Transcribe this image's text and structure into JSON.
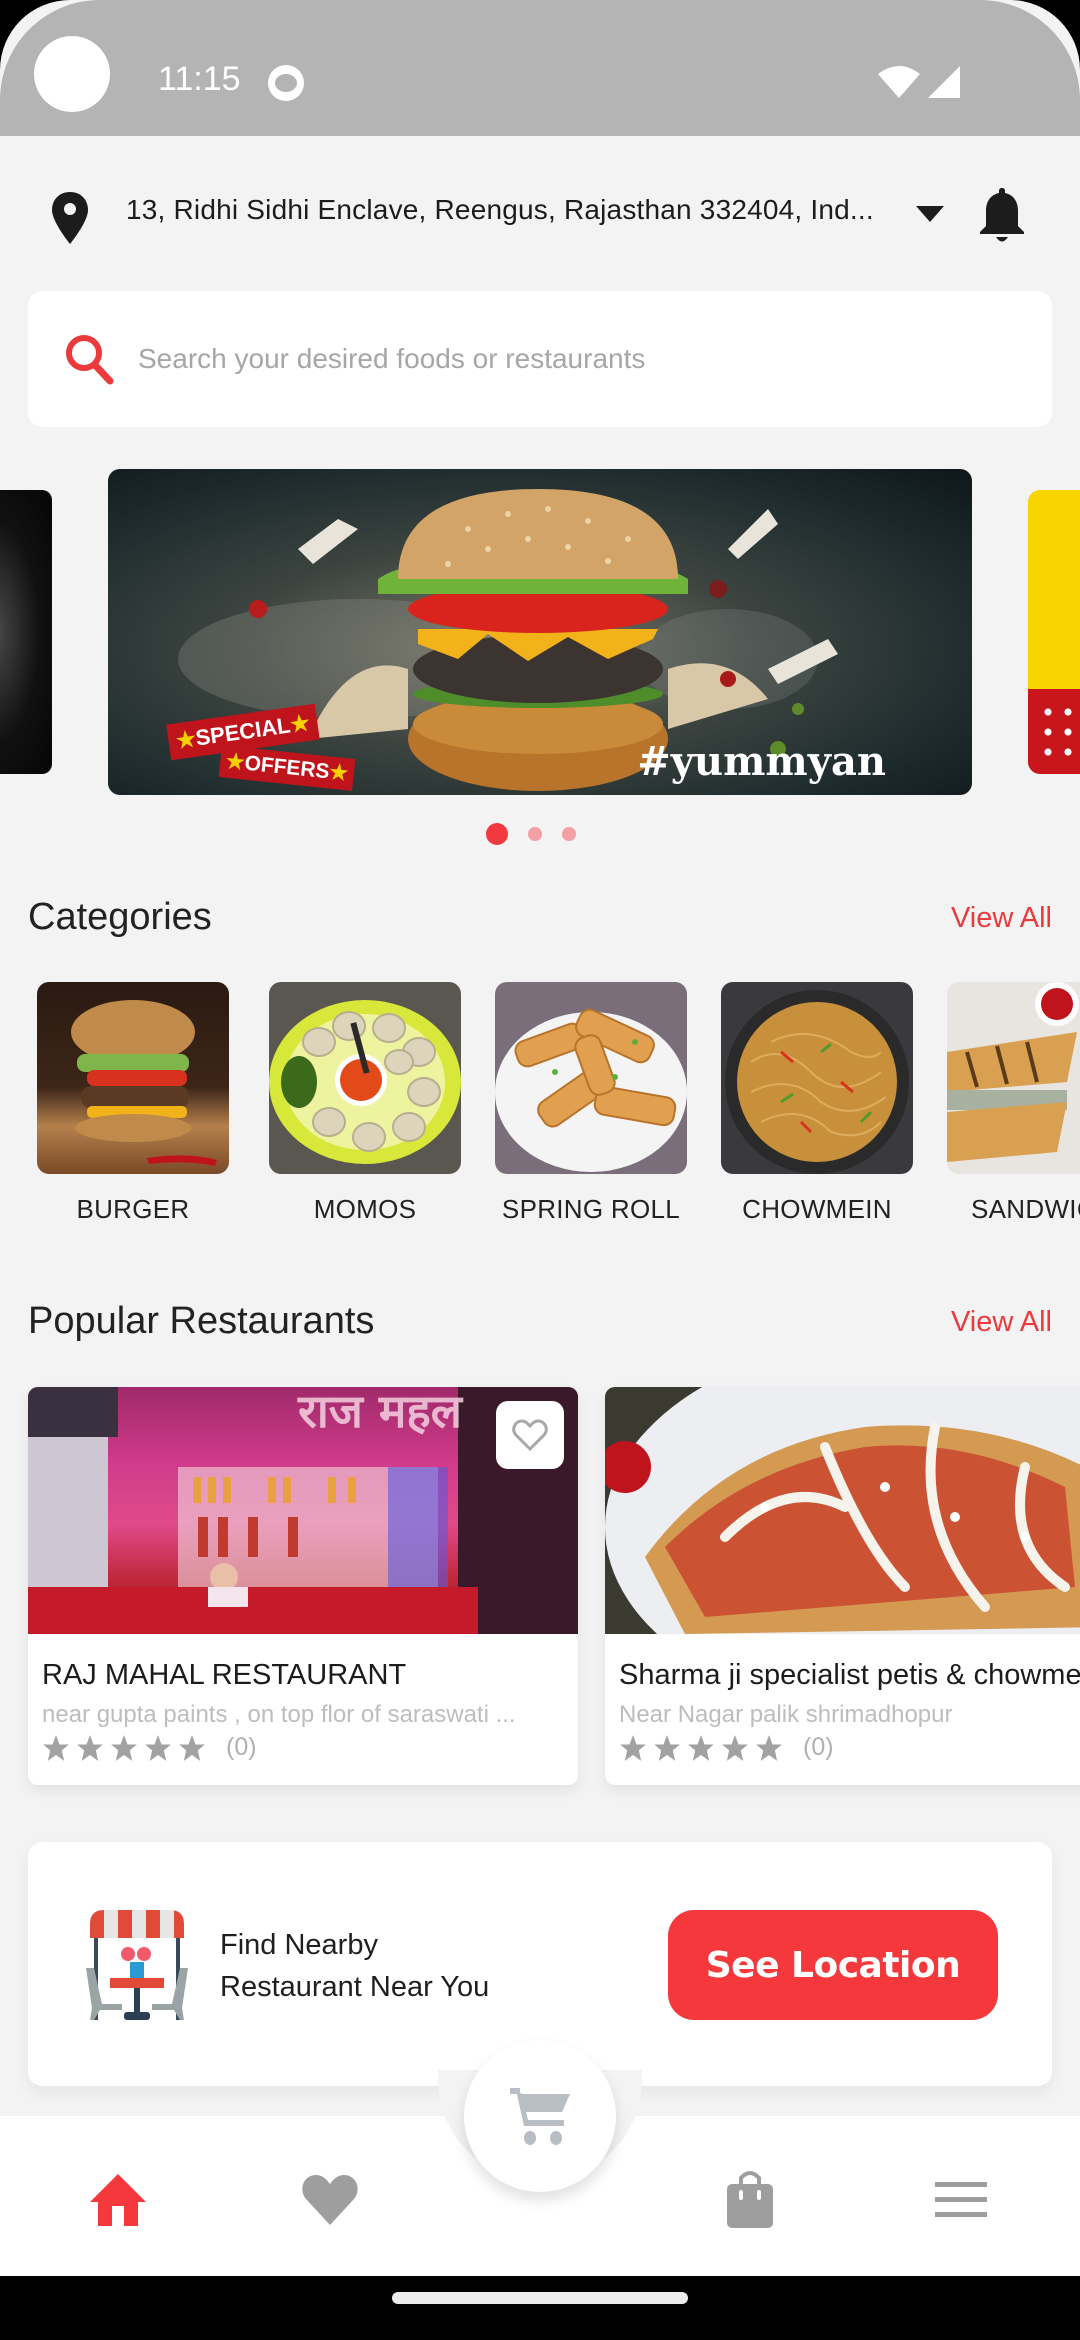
{
  "status_bar": {
    "time": "11:15",
    "icons": [
      "camera-cutout",
      "app-notification-icon",
      "wifi-icon",
      "signal-icon"
    ]
  },
  "header": {
    "location_icon": "map-pin-icon",
    "address": "13, Ridhi Sidhi Enclave, Reengus, Rajasthan 332404, Ind...",
    "dropdown_icon": "caret-down-icon",
    "notification_icon": "bell-icon"
  },
  "search": {
    "icon": "search-icon",
    "placeholder": "Search your desired foods or restaurants",
    "value": ""
  },
  "banner": {
    "tagline": "#yummyan",
    "badge_line1": "SPECIAL",
    "badge_line2": "OFFERS",
    "slide_count": 3,
    "active_slide": 1
  },
  "categories": {
    "title": "Categories",
    "view_all": "View All",
    "items": [
      {
        "label": "BURGER"
      },
      {
        "label": "MOMOS"
      },
      {
        "label": "SPRING ROLL"
      },
      {
        "label": "CHOWMEIN"
      },
      {
        "label": "SANDWICH"
      }
    ]
  },
  "restaurants": {
    "title": "Popular Restaurants",
    "view_all": "View All",
    "items": [
      {
        "name": "RAJ MAHAL RESTAURANT",
        "address": "near gupta paints , on top flor of saraswati ...",
        "rating": 0,
        "rating_count": "(0)",
        "favorite": false
      },
      {
        "name": "Sharma ji specialist petis & chowmein",
        "address": "Near Nagar palik shrimadhopur",
        "rating": 0,
        "rating_count": "(0)",
        "favorite": false
      }
    ]
  },
  "nearby": {
    "line1": "Find Nearby",
    "line2": "Restaurant Near You",
    "button": "See Location"
  },
  "bottom_nav": {
    "items": [
      {
        "name": "home",
        "icon": "home-icon",
        "active": true
      },
      {
        "name": "favorites",
        "icon": "heart-icon",
        "active": false
      },
      {
        "name": "cart",
        "icon": "cart-icon",
        "active": false
      },
      {
        "name": "orders",
        "icon": "shopping-bag-icon",
        "active": false
      },
      {
        "name": "menu",
        "icon": "menu-icon",
        "active": false
      }
    ]
  },
  "colors": {
    "accent": "#F5383B",
    "background": "#F3F3F3",
    "status_bar": "#B4B4B4",
    "inactive_icon": "#9E9E9E"
  }
}
